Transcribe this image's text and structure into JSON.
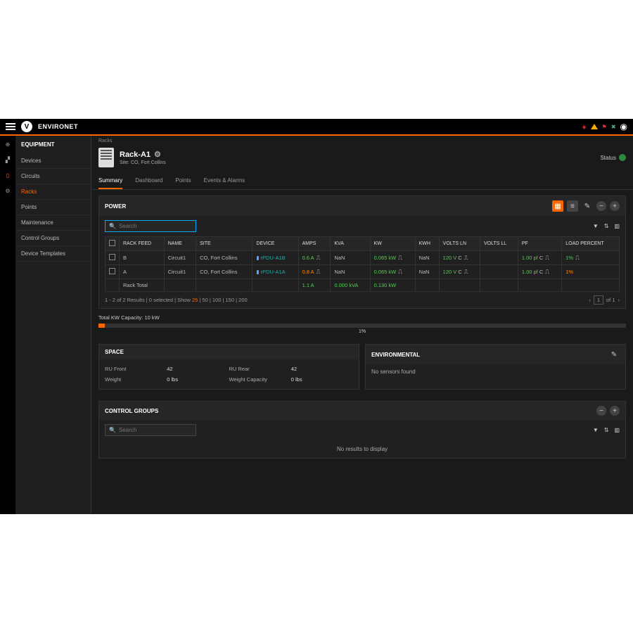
{
  "brand": "ENVIRONET",
  "sidebar": {
    "header": "EQUIPMENT",
    "items": [
      "Devices",
      "Circuits",
      "Racks",
      "Points",
      "Maintenance",
      "Control Groups",
      "Device Templates"
    ],
    "active": 2
  },
  "breadcrumb": "Racks",
  "page": {
    "title": "Rack-A1",
    "site": "Site: CO, Fort Collins",
    "status_label": "Status"
  },
  "tabs": [
    "Summary",
    "Dashboard",
    "Points",
    "Events & Alarms"
  ],
  "power": {
    "title": "POWER",
    "search_placeholder": "Search",
    "columns": [
      "",
      "RACK FEED",
      "NAME",
      "SITE",
      "DEVICE",
      "AMPS",
      "KVA",
      "KW",
      "KWH",
      "VOLTS LN",
      "VOLTS LL",
      "PF",
      "LOAD PERCENT"
    ],
    "rows": [
      {
        "feed": "B",
        "name": "Circuit1",
        "site": "CO, Fort Collins",
        "device": "rPDU-A1B",
        "amps": "0.6 A",
        "kva": "NaN",
        "kw": "0.065 kW",
        "kwh": "NaN",
        "vln": "120 V",
        "vll": "",
        "pf": "1.00 pf",
        "load": "1%"
      },
      {
        "feed": "A",
        "name": "Circuit1",
        "site": "CO, Fort Collins",
        "device": "rPDU-A1A",
        "amps": "0.8 A",
        "kva": "NaN",
        "kw": "0.065 kW",
        "kwh": "NaN",
        "vln": "120 V",
        "vll": "",
        "pf": "1.00 pf",
        "load": "1%"
      }
    ],
    "total": {
      "label": "Rack Total",
      "amps": "1.1 A",
      "kva": "0.000 kVA",
      "kw": "0.130 kW"
    },
    "pager_left_a": "1 - 2 of 2 Results | 0 selected | Show ",
    "pager_left_b": "25",
    "pager_left_c": " | 50 | 100 | 150 | 200",
    "page_num": "1",
    "page_of": "of 1"
  },
  "capacity": {
    "label": "Total KW Capacity: 10 kW",
    "pct": "1%"
  },
  "space": {
    "title": "SPACE",
    "ru_front_l": "RU Front",
    "ru_front_v": "42",
    "ru_rear_l": "RU Rear",
    "ru_rear_v": "42",
    "weight_l": "Weight",
    "weight_v": "0 lbs",
    "wcap_l": "Weight Capacity",
    "wcap_v": "0 lbs"
  },
  "env": {
    "title": "ENVIRONMENTAL",
    "msg": "No sensors found"
  },
  "cg": {
    "title": "CONTROL GROUPS",
    "search_placeholder": "Search",
    "empty": "No results to display"
  }
}
